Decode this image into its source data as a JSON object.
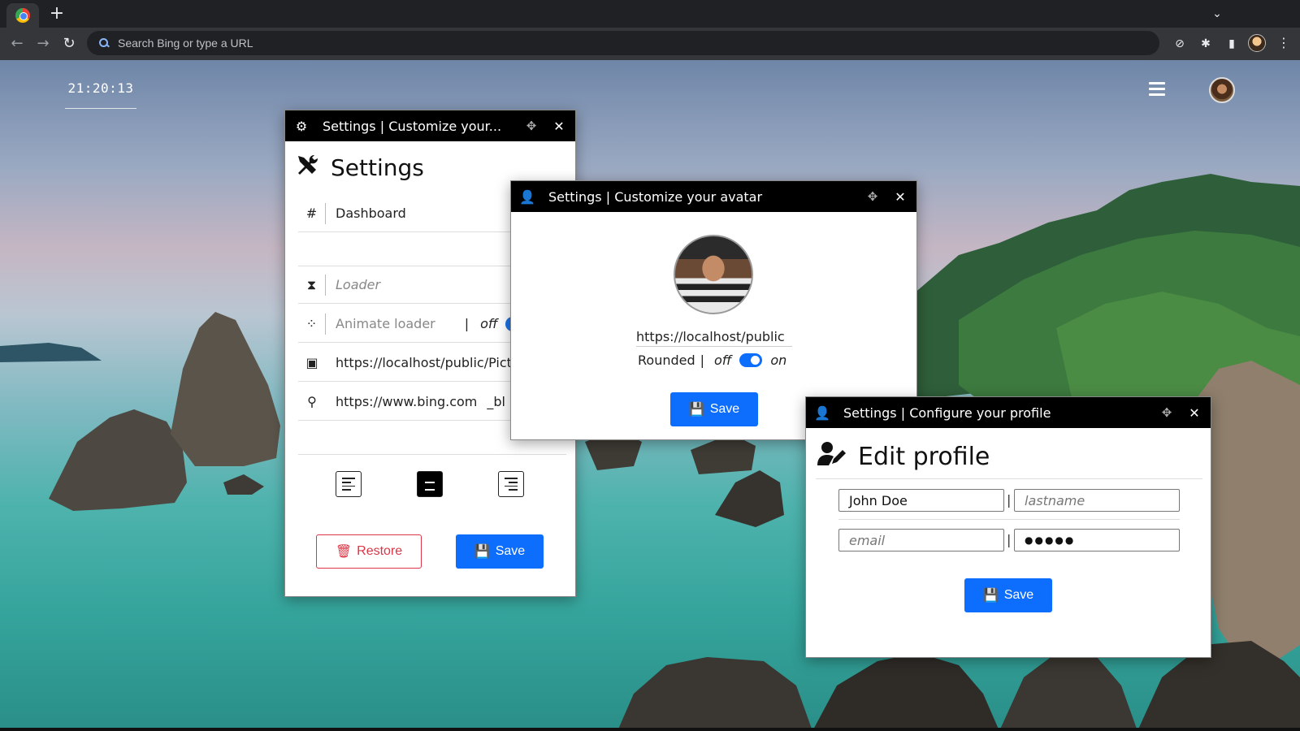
{
  "browser": {
    "omnibox_placeholder": "Search Bing or type a URL",
    "new_tab_label": "+"
  },
  "desktop": {
    "clock": "21:20:13"
  },
  "settings_window": {
    "title": "Settings | Customize your...",
    "heading": "Settings",
    "rows": {
      "dashboard": "Dashboard",
      "loader": "Loader",
      "animate_loader": "Animate loader",
      "animate_sep": "|",
      "animate_off": "off",
      "picture_url": "https://localhost/public/Pict",
      "search_url": "https://www.bing.com",
      "search_target": "_bl"
    },
    "alignment_selected": "center",
    "restore_label": "Restore",
    "save_label": "Save"
  },
  "avatar_window": {
    "title": "Settings | Customize your avatar",
    "url": "https://localhost/public",
    "rounded_label": "Rounded",
    "rounded_sep": "|",
    "off_label": "off",
    "on_label": "on",
    "rounded_enabled": true,
    "save_label": "Save"
  },
  "profile_window": {
    "title": "Settings | Configure your profile",
    "heading": "Edit profile",
    "firstname_value": "John Doe",
    "lastname_placeholder": "lastname",
    "email_placeholder": "email",
    "password_mask": "●●●●●",
    "pipe": "|",
    "save_label": "Save"
  },
  "colors": {
    "primary": "#0d6efd",
    "danger": "#dc3545",
    "titlebar": "#000000"
  }
}
